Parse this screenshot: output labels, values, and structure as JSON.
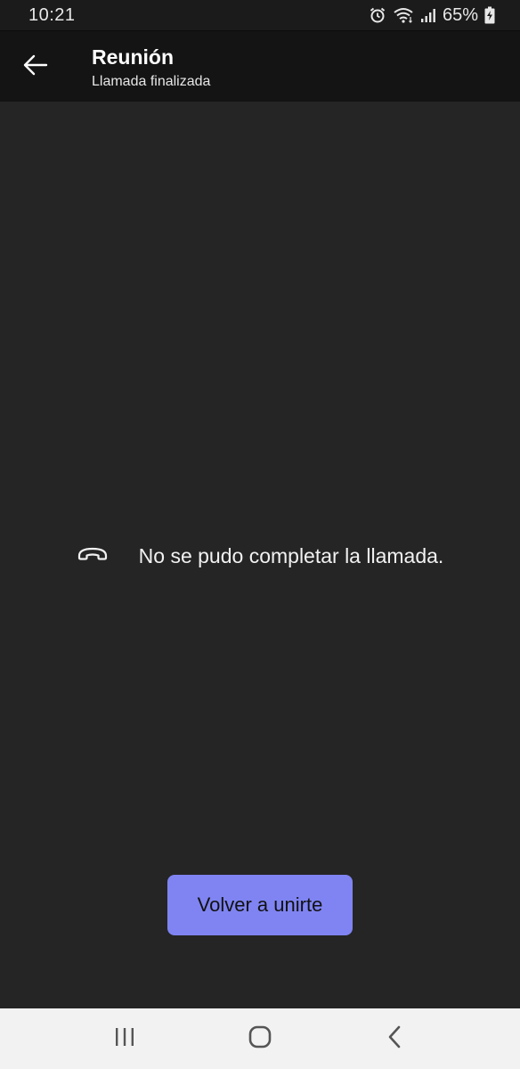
{
  "status_bar": {
    "time": "10:21",
    "battery": "65%",
    "icons": [
      "alarm-icon",
      "wifi-icon",
      "signal-icon",
      "battery-charging-icon"
    ]
  },
  "header": {
    "title": "Reunión",
    "subtitle": "Llamada finalizada",
    "back_icon": "arrow-left-icon"
  },
  "message": {
    "icon": "call-end-icon",
    "text": "No se pudo completar la llamada."
  },
  "rejoin_button": {
    "label": "Volver a unirte"
  },
  "nav_bar": {
    "icons": [
      "recent-apps-icon",
      "home-icon",
      "back-icon"
    ]
  },
  "colors": {
    "background": "#252525",
    "header_background": "#141414",
    "accent": "#7f84f2",
    "nav_background": "#f2f2f2"
  }
}
